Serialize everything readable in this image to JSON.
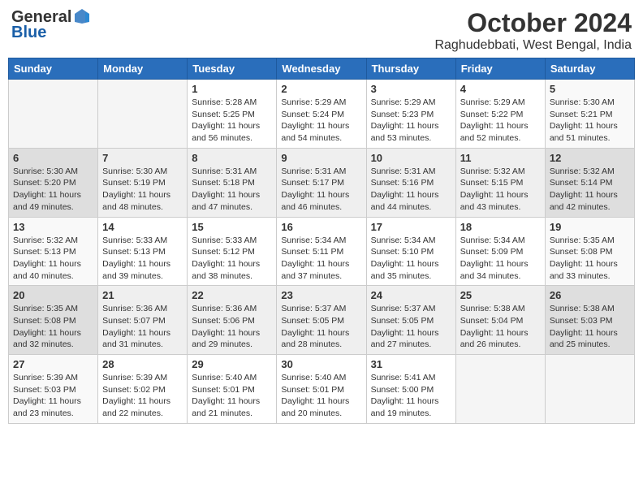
{
  "header": {
    "logo_general": "General",
    "logo_blue": "Blue",
    "month": "October 2024",
    "location": "Raghudebbati, West Bengal, India"
  },
  "weekdays": [
    "Sunday",
    "Monday",
    "Tuesday",
    "Wednesday",
    "Thursday",
    "Friday",
    "Saturday"
  ],
  "weeks": [
    [
      {
        "day": "",
        "sunrise": "",
        "sunset": "",
        "daylight": ""
      },
      {
        "day": "",
        "sunrise": "",
        "sunset": "",
        "daylight": ""
      },
      {
        "day": "1",
        "sunrise": "Sunrise: 5:28 AM",
        "sunset": "Sunset: 5:25 PM",
        "daylight": "Daylight: 11 hours and 56 minutes."
      },
      {
        "day": "2",
        "sunrise": "Sunrise: 5:29 AM",
        "sunset": "Sunset: 5:24 PM",
        "daylight": "Daylight: 11 hours and 54 minutes."
      },
      {
        "day": "3",
        "sunrise": "Sunrise: 5:29 AM",
        "sunset": "Sunset: 5:23 PM",
        "daylight": "Daylight: 11 hours and 53 minutes."
      },
      {
        "day": "4",
        "sunrise": "Sunrise: 5:29 AM",
        "sunset": "Sunset: 5:22 PM",
        "daylight": "Daylight: 11 hours and 52 minutes."
      },
      {
        "day": "5",
        "sunrise": "Sunrise: 5:30 AM",
        "sunset": "Sunset: 5:21 PM",
        "daylight": "Daylight: 11 hours and 51 minutes."
      }
    ],
    [
      {
        "day": "6",
        "sunrise": "Sunrise: 5:30 AM",
        "sunset": "Sunset: 5:20 PM",
        "daylight": "Daylight: 11 hours and 49 minutes."
      },
      {
        "day": "7",
        "sunrise": "Sunrise: 5:30 AM",
        "sunset": "Sunset: 5:19 PM",
        "daylight": "Daylight: 11 hours and 48 minutes."
      },
      {
        "day": "8",
        "sunrise": "Sunrise: 5:31 AM",
        "sunset": "Sunset: 5:18 PM",
        "daylight": "Daylight: 11 hours and 47 minutes."
      },
      {
        "day": "9",
        "sunrise": "Sunrise: 5:31 AM",
        "sunset": "Sunset: 5:17 PM",
        "daylight": "Daylight: 11 hours and 46 minutes."
      },
      {
        "day": "10",
        "sunrise": "Sunrise: 5:31 AM",
        "sunset": "Sunset: 5:16 PM",
        "daylight": "Daylight: 11 hours and 44 minutes."
      },
      {
        "day": "11",
        "sunrise": "Sunrise: 5:32 AM",
        "sunset": "Sunset: 5:15 PM",
        "daylight": "Daylight: 11 hours and 43 minutes."
      },
      {
        "day": "12",
        "sunrise": "Sunrise: 5:32 AM",
        "sunset": "Sunset: 5:14 PM",
        "daylight": "Daylight: 11 hours and 42 minutes."
      }
    ],
    [
      {
        "day": "13",
        "sunrise": "Sunrise: 5:32 AM",
        "sunset": "Sunset: 5:13 PM",
        "daylight": "Daylight: 11 hours and 40 minutes."
      },
      {
        "day": "14",
        "sunrise": "Sunrise: 5:33 AM",
        "sunset": "Sunset: 5:13 PM",
        "daylight": "Daylight: 11 hours and 39 minutes."
      },
      {
        "day": "15",
        "sunrise": "Sunrise: 5:33 AM",
        "sunset": "Sunset: 5:12 PM",
        "daylight": "Daylight: 11 hours and 38 minutes."
      },
      {
        "day": "16",
        "sunrise": "Sunrise: 5:34 AM",
        "sunset": "Sunset: 5:11 PM",
        "daylight": "Daylight: 11 hours and 37 minutes."
      },
      {
        "day": "17",
        "sunrise": "Sunrise: 5:34 AM",
        "sunset": "Sunset: 5:10 PM",
        "daylight": "Daylight: 11 hours and 35 minutes."
      },
      {
        "day": "18",
        "sunrise": "Sunrise: 5:34 AM",
        "sunset": "Sunset: 5:09 PM",
        "daylight": "Daylight: 11 hours and 34 minutes."
      },
      {
        "day": "19",
        "sunrise": "Sunrise: 5:35 AM",
        "sunset": "Sunset: 5:08 PM",
        "daylight": "Daylight: 11 hours and 33 minutes."
      }
    ],
    [
      {
        "day": "20",
        "sunrise": "Sunrise: 5:35 AM",
        "sunset": "Sunset: 5:08 PM",
        "daylight": "Daylight: 11 hours and 32 minutes."
      },
      {
        "day": "21",
        "sunrise": "Sunrise: 5:36 AM",
        "sunset": "Sunset: 5:07 PM",
        "daylight": "Daylight: 11 hours and 31 minutes."
      },
      {
        "day": "22",
        "sunrise": "Sunrise: 5:36 AM",
        "sunset": "Sunset: 5:06 PM",
        "daylight": "Daylight: 11 hours and 29 minutes."
      },
      {
        "day": "23",
        "sunrise": "Sunrise: 5:37 AM",
        "sunset": "Sunset: 5:05 PM",
        "daylight": "Daylight: 11 hours and 28 minutes."
      },
      {
        "day": "24",
        "sunrise": "Sunrise: 5:37 AM",
        "sunset": "Sunset: 5:05 PM",
        "daylight": "Daylight: 11 hours and 27 minutes."
      },
      {
        "day": "25",
        "sunrise": "Sunrise: 5:38 AM",
        "sunset": "Sunset: 5:04 PM",
        "daylight": "Daylight: 11 hours and 26 minutes."
      },
      {
        "day": "26",
        "sunrise": "Sunrise: 5:38 AM",
        "sunset": "Sunset: 5:03 PM",
        "daylight": "Daylight: 11 hours and 25 minutes."
      }
    ],
    [
      {
        "day": "27",
        "sunrise": "Sunrise: 5:39 AM",
        "sunset": "Sunset: 5:03 PM",
        "daylight": "Daylight: 11 hours and 23 minutes."
      },
      {
        "day": "28",
        "sunrise": "Sunrise: 5:39 AM",
        "sunset": "Sunset: 5:02 PM",
        "daylight": "Daylight: 11 hours and 22 minutes."
      },
      {
        "day": "29",
        "sunrise": "Sunrise: 5:40 AM",
        "sunset": "Sunset: 5:01 PM",
        "daylight": "Daylight: 11 hours and 21 minutes."
      },
      {
        "day": "30",
        "sunrise": "Sunrise: 5:40 AM",
        "sunset": "Sunset: 5:01 PM",
        "daylight": "Daylight: 11 hours and 20 minutes."
      },
      {
        "day": "31",
        "sunrise": "Sunrise: 5:41 AM",
        "sunset": "Sunset: 5:00 PM",
        "daylight": "Daylight: 11 hours and 19 minutes."
      },
      {
        "day": "",
        "sunrise": "",
        "sunset": "",
        "daylight": ""
      },
      {
        "day": "",
        "sunrise": "",
        "sunset": "",
        "daylight": ""
      }
    ]
  ]
}
